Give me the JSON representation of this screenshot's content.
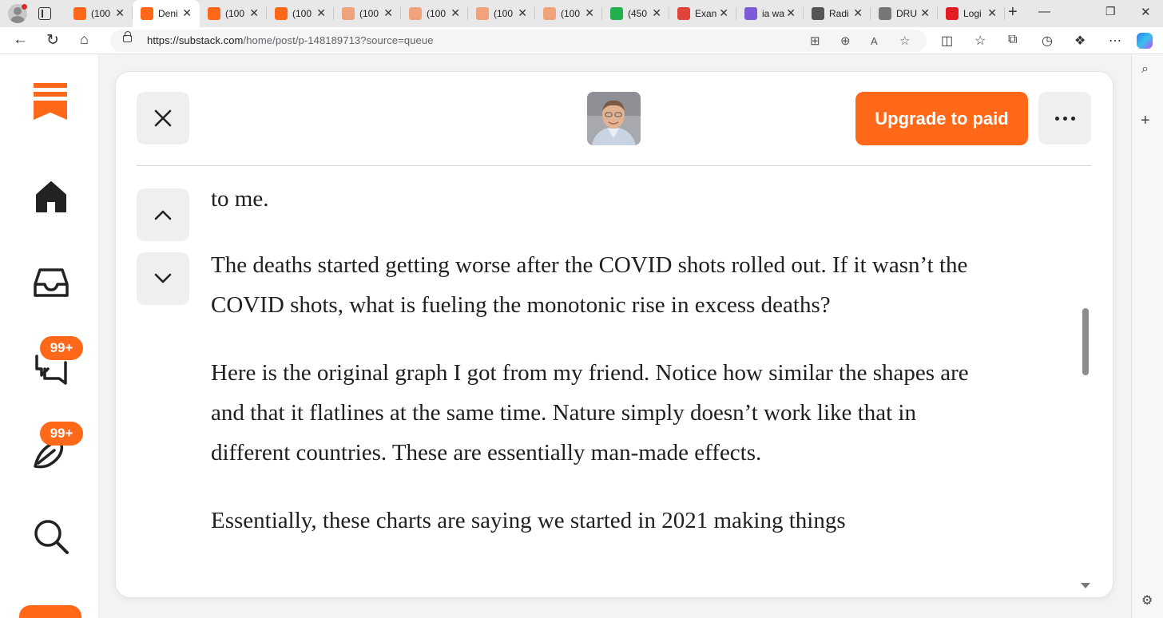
{
  "browser": {
    "tabs": [
      {
        "title": "(100",
        "favicon": "substack-icon",
        "color": "#ff6719",
        "active": false
      },
      {
        "title": "Deni",
        "favicon": "substack-icon",
        "color": "#ff6719",
        "active": true
      },
      {
        "title": "(100",
        "favicon": "substack-icon",
        "color": "#ff6719",
        "active": false
      },
      {
        "title": "(100",
        "favicon": "substack-icon",
        "color": "#ff6719",
        "active": false
      },
      {
        "title": "(100",
        "favicon": "substack-icon",
        "color": "#f0a27a",
        "active": false
      },
      {
        "title": "(100",
        "favicon": "substack-icon",
        "color": "#f0a27a",
        "active": false
      },
      {
        "title": "(100",
        "favicon": "substack-icon",
        "color": "#f0a27a",
        "active": false
      },
      {
        "title": "(100",
        "favicon": "substack-icon",
        "color": "#f0a27a",
        "active": false
      },
      {
        "title": "(450",
        "favicon": "gettr-g-icon",
        "color": "#22b14c",
        "active": false
      },
      {
        "title": "Exan",
        "favicon": "youtube-icon",
        "color": "#e0443b",
        "active": false
      },
      {
        "title": "ia wa",
        "favicon": "yahoo-icon",
        "color": "#7b5cd6",
        "active": false
      },
      {
        "title": "Radi",
        "favicon": "x-icon",
        "color": "#555555",
        "active": false
      },
      {
        "title": "DRU",
        "favicon": "drudge-icon",
        "color": "#777777",
        "active": false
      },
      {
        "title": "Logi",
        "favicon": "login-icon",
        "color": "#e31b23",
        "active": false
      }
    ],
    "url_host": "https://substack.com",
    "url_path": "/home/post/p-148189713?source=queue"
  },
  "reader": {
    "upgrade_label": "Upgrade to paid",
    "paragraphs": [
      "to me.",
      "The deaths started getting worse after the COVID shots rolled out. If it wasn’t the COVID shots, what is fueling the monotonic rise in excess deaths?",
      "Here is the original graph I got from my friend. Notice how similar the shapes are and that it flatlines at the same time. Nature simply doesn’t work like that in different countries. These are essentially man-made effects.",
      "Essentially, these charts are saying we started in 2021 making things"
    ]
  },
  "nav": {
    "chat_badge": "99+",
    "activity_badge": "99+"
  },
  "colors": {
    "brand": "#ff6719",
    "text": "#202020"
  }
}
